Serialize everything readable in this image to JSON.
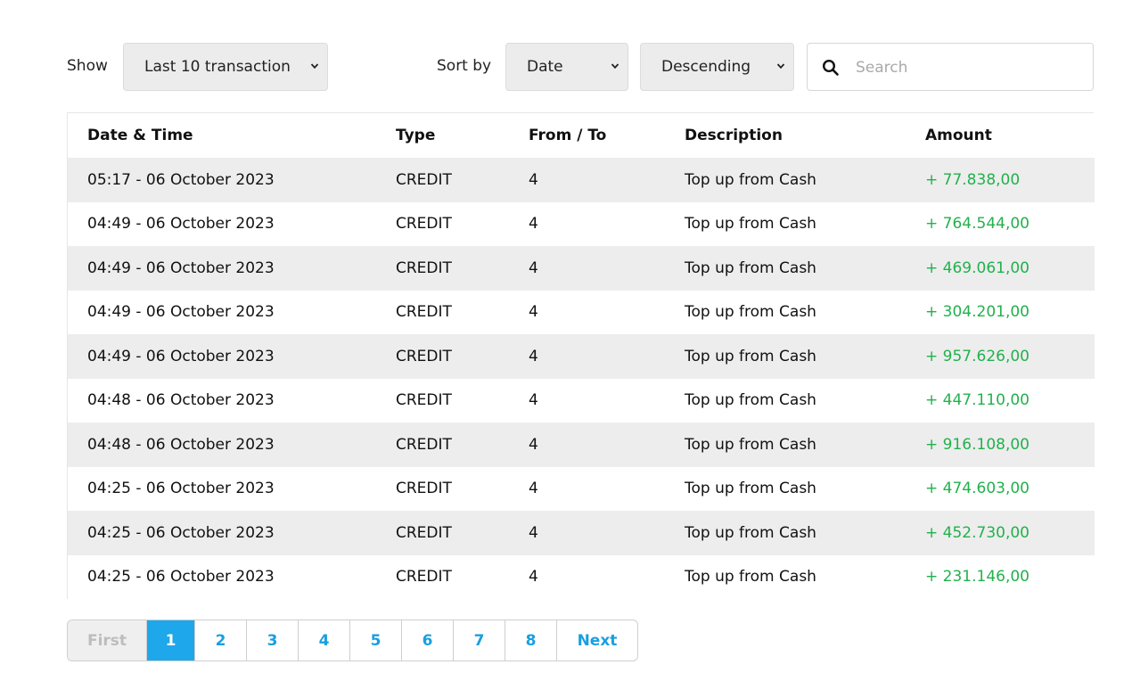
{
  "filters": {
    "show_label": "Show",
    "show_value": "Last 10 transaction",
    "sort_label": "Sort by",
    "sort_value": "Date",
    "order_value": "Descending",
    "search_placeholder": "Search"
  },
  "table": {
    "headers": [
      "Date & Time",
      "Type",
      "From / To",
      "Description",
      "Amount"
    ],
    "rows": [
      [
        "05:17 - 06 October 2023",
        "CREDIT",
        "4",
        "Top up from Cash",
        "+ 77.838,00"
      ],
      [
        "04:49 - 06 October 2023",
        "CREDIT",
        "4",
        "Top up from Cash",
        "+ 764.544,00"
      ],
      [
        "04:49 - 06 October 2023",
        "CREDIT",
        "4",
        "Top up from Cash",
        "+ 469.061,00"
      ],
      [
        "04:49 - 06 October 2023",
        "CREDIT",
        "4",
        "Top up from Cash",
        "+ 304.201,00"
      ],
      [
        "04:49 - 06 October 2023",
        "CREDIT",
        "4",
        "Top up from Cash",
        "+ 957.626,00"
      ],
      [
        "04:48 - 06 October 2023",
        "CREDIT",
        "4",
        "Top up from Cash",
        "+ 447.110,00"
      ],
      [
        "04:48 - 06 October 2023",
        "CREDIT",
        "4",
        "Top up from Cash",
        "+ 916.108,00"
      ],
      [
        "04:25 - 06 October 2023",
        "CREDIT",
        "4",
        "Top up from Cash",
        "+ 474.603,00"
      ],
      [
        "04:25 - 06 October 2023",
        "CREDIT",
        "4",
        "Top up from Cash",
        "+ 452.730,00"
      ],
      [
        "04:25 - 06 October 2023",
        "CREDIT",
        "4",
        "Top up from Cash",
        "+ 231.146,00"
      ]
    ]
  },
  "pagination": {
    "first_label": "First",
    "pages": [
      "1",
      "2",
      "3",
      "4",
      "5",
      "6",
      "7",
      "8"
    ],
    "active_page": "1",
    "next_label": "Next"
  },
  "colors": {
    "amount_positive": "#22b14c",
    "accent": "#1ea7ea",
    "stripe": "#ededed"
  },
  "icons": {
    "search": "search-icon",
    "dropdown": "chevron-down-icon"
  }
}
